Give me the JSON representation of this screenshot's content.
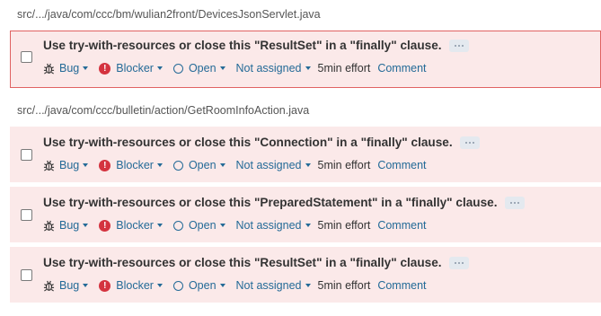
{
  "groups": [
    {
      "file": "src/.../java/com/ccc/bm/wulian2front/DevicesJsonServlet.java",
      "issues": [
        {
          "message": "Use try-with-resources or close this \"ResultSet\" in a \"finally\" clause.",
          "type": "Bug",
          "severity": "Blocker",
          "status": "Open",
          "assignee": "Not assigned",
          "effort": "5min effort",
          "comment": "Comment",
          "selected": true
        }
      ]
    },
    {
      "file": "src/.../java/com/ccc/bulletin/action/GetRoomInfoAction.java",
      "issues": [
        {
          "message": "Use try-with-resources or close this \"Connection\" in a \"finally\" clause.",
          "type": "Bug",
          "severity": "Blocker",
          "status": "Open",
          "assignee": "Not assigned",
          "effort": "5min effort",
          "comment": "Comment",
          "selected": false
        },
        {
          "message": "Use try-with-resources or close this \"PreparedStatement\" in a \"finally\" clause.",
          "type": "Bug",
          "severity": "Blocker",
          "status": "Open",
          "assignee": "Not assigned",
          "effort": "5min effort",
          "comment": "Comment",
          "selected": false
        },
        {
          "message": "Use try-with-resources or close this \"ResultSet\" in a \"finally\" clause.",
          "type": "Bug",
          "severity": "Blocker",
          "status": "Open",
          "assignee": "Not assigned",
          "effort": "5min effort",
          "comment": "Comment",
          "selected": false
        }
      ]
    }
  ],
  "colors": {
    "issue_bg": "#fbe9e9",
    "selected_border": "#e06262",
    "link": "#236a97",
    "blocker": "#d4333f"
  },
  "icons": {
    "type": "bug-icon",
    "severity": "blocker-icon",
    "status": "open-circle-icon",
    "more": "more-actions-icon"
  }
}
